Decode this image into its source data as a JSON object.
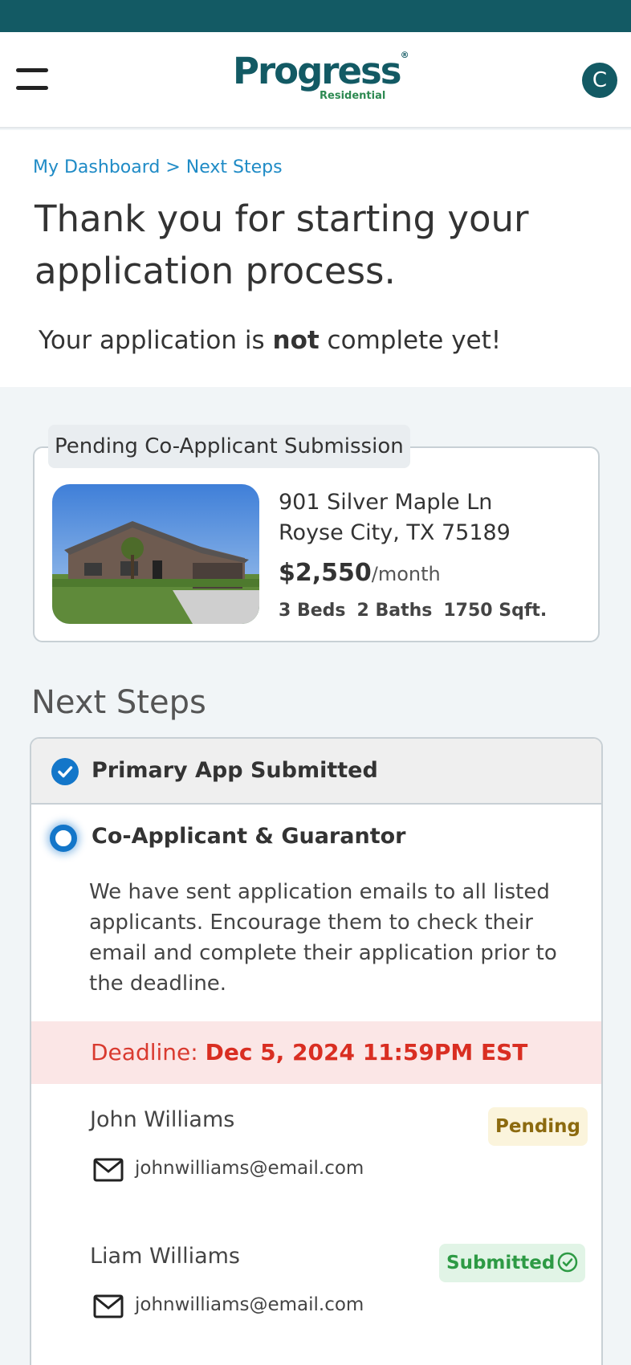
{
  "header": {
    "logo_text": "Progress",
    "logo_reg": "®",
    "logo_sub": "Residential",
    "avatar_initial": "C"
  },
  "breadcrumb": {
    "dashboard": "My Dashboard",
    "separator": " > ",
    "current": "Next Steps"
  },
  "intro": {
    "title": "Thank you for starting your application process.",
    "subtitle_pre": "Your application is ",
    "subtitle_bold": "not",
    "subtitle_post": " complete yet!"
  },
  "property": {
    "status_label": "Pending Co-Applicant Submission",
    "address_line1": "901 Silver Maple Ln",
    "address_line2": "Royse City, TX 75189",
    "price": "$2,550",
    "price_unit": "/month",
    "beds": "3 Beds",
    "baths": "2 Baths",
    "sqft": "1750 Sqft."
  },
  "next_steps": {
    "heading": "Next Steps",
    "step1_label": "Primary App Submitted",
    "step2_label": "Co-Applicant & Guarantor",
    "step2_body": "We have sent application emails to all listed applicants. Encourage them to check their email and complete their application prior to the deadline.",
    "deadline_label": "Deadline: ",
    "deadline_value": "Dec 5, 2024 11:59PM EST",
    "applicants": [
      {
        "name": "John Williams",
        "email": "johnwilliams@email.com",
        "status": "Pending"
      },
      {
        "name": "Liam Williams",
        "email": "johnwilliams@email.com",
        "status": "Submitted"
      }
    ]
  },
  "colors": {
    "brand_teal": "#135a64",
    "link_blue": "#1f8bc6",
    "step_blue": "#1376c9",
    "deadline_red": "#d92e22",
    "pending_gold": "#8c6a0f",
    "submitted_green": "#2d9a44"
  },
  "icons": {
    "menu": "hamburger-icon",
    "check": "check-circle-icon",
    "radio": "radio-active-icon",
    "mail": "mail-icon",
    "submitted": "check-outline-icon"
  }
}
